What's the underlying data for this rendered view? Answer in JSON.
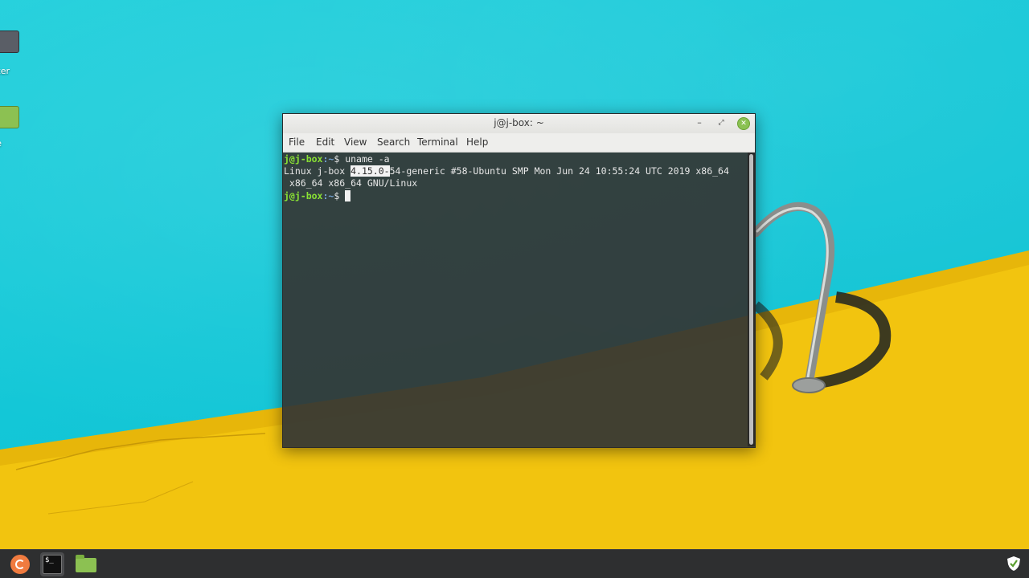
{
  "desktop": {
    "icons": [
      {
        "label": "uter"
      },
      {
        "label": "me"
      }
    ]
  },
  "terminal": {
    "title": "j@j-box: ~",
    "window_controls": {
      "minimize": "–",
      "maximize": "⤢",
      "close": "✕"
    },
    "menu": [
      "File",
      "Edit",
      "View",
      "Search",
      "Terminal",
      "Help"
    ],
    "prompt_user": "j@j-box",
    "prompt_path": ":~",
    "prompt_symbol": "$",
    "command": "uname -a",
    "output_prefix": "Linux j-box ",
    "output_selected": "4.15.0-",
    "output_rest": "54-generic #58-Ubuntu SMP Mon Jun 24 10:55:24 UTC 2019 x86_64",
    "output_line2": " x86_64 x86_64 GNU/Linux"
  },
  "taskbar": {
    "terminal_glyph": "$_"
  },
  "colors": {
    "prompt_user": "#8ae234",
    "prompt_path": "#729fcf",
    "close_button": "#8ac152",
    "taskbar": "#2e2f30",
    "water": "#13c7d7",
    "pool_deck": "#f2c40f"
  }
}
